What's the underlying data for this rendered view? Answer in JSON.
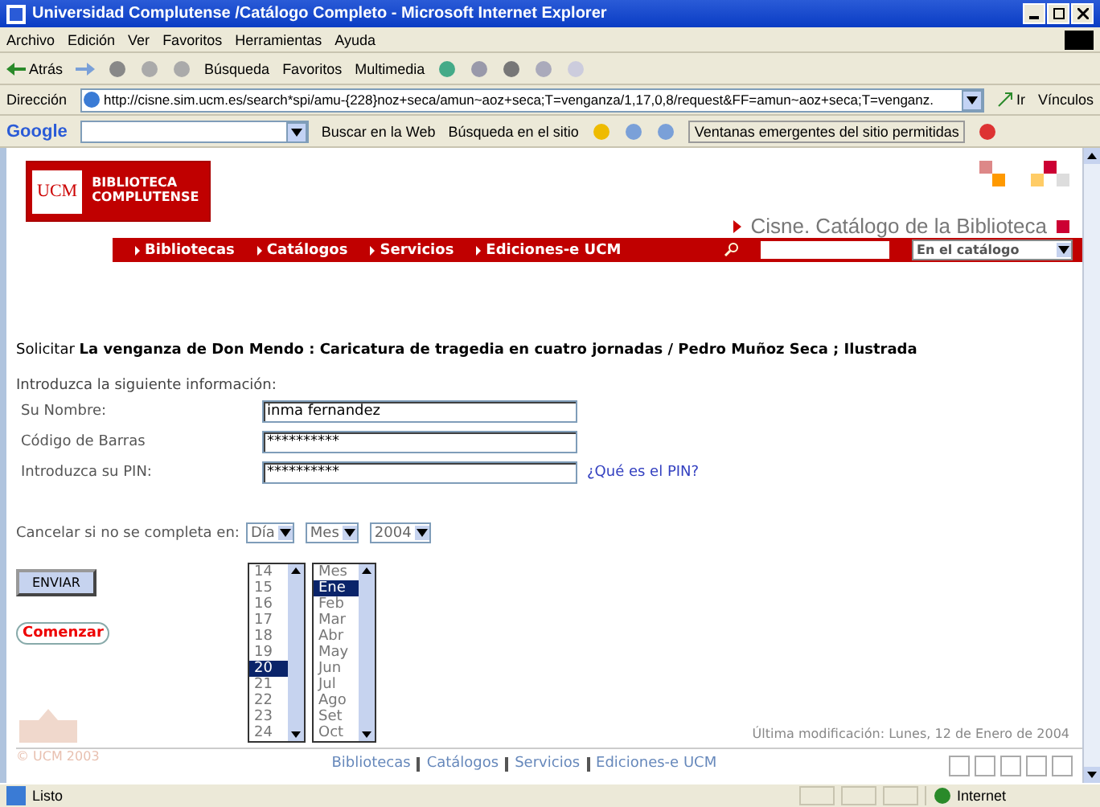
{
  "window": {
    "title": "Universidad Complutense /Catálogo Completo - Microsoft Internet Explorer"
  },
  "menu": [
    "Archivo",
    "Edición",
    "Ver",
    "Favoritos",
    "Herramientas",
    "Ayuda"
  ],
  "toolbar": {
    "back": "Atrás",
    "search": "Búsqueda",
    "favorites": "Favoritos",
    "media": "Multimedia"
  },
  "address": {
    "label": "Dirección",
    "url": "http://cisne.sim.ucm.es/search*spi/amu-{228}noz+seca/amun~aoz+seca;T=venganza/1,17,0,8/request&FF=amun~aoz+seca;T=venganz.",
    "go": "Ir",
    "links": "Vínculos"
  },
  "google_bar": {
    "logo": "Google",
    "web_search": "Buscar en la Web",
    "site_search": "Búsqueda en el sitio",
    "popups": "Ventanas emergentes del sitio permitidas"
  },
  "page": {
    "logo_mark": "UCM",
    "logo_text": [
      "BIBLIOTECA",
      "COMPLUTENSE"
    ],
    "catalog_title": "Cisne. Catálogo de la Biblioteca",
    "nav": [
      "Bibliotecas",
      "Catálogos",
      "Servicios",
      "Ediciones-e UCM"
    ],
    "search_scope": "En el catálogo",
    "request_label": "Solicitar",
    "request_title": "La venganza de Don Mendo : Caricatura de tragedia en cuatro jornadas / Pedro Muñoz Seca ; Ilustrada",
    "intro": "Introduzca la siguiente información:",
    "fields": [
      {
        "label": "Su Nombre:",
        "value": "inma fernandez"
      },
      {
        "label": "Código de Barras",
        "value": "**********"
      },
      {
        "label": "Introduzca su PIN:",
        "value": "**********"
      }
    ],
    "pin_link": "¿Qué es el PIN?",
    "cancel_label": "Cancelar si no se completa en:",
    "selects": [
      "Día",
      "Mes",
      "2004"
    ],
    "day_options": [
      {
        "label": "14",
        "selected": false
      },
      {
        "label": "15",
        "selected": false
      },
      {
        "label": "16",
        "selected": false
      },
      {
        "label": "17",
        "selected": false
      },
      {
        "label": "18",
        "selected": false
      },
      {
        "label": "19",
        "selected": false
      },
      {
        "label": "20",
        "selected": true
      },
      {
        "label": "21",
        "selected": false
      },
      {
        "label": "22",
        "selected": false
      },
      {
        "label": "23",
        "selected": false
      },
      {
        "label": "24",
        "selected": false
      }
    ],
    "month_options": [
      {
        "label": "Mes",
        "selected": false
      },
      {
        "label": "Ene",
        "selected": true
      },
      {
        "label": "Feb",
        "selected": false
      },
      {
        "label": "Mar",
        "selected": false
      },
      {
        "label": "Abr",
        "selected": false
      },
      {
        "label": "May",
        "selected": false
      },
      {
        "label": "Jun",
        "selected": false
      },
      {
        "label": "Jul",
        "selected": false
      },
      {
        "label": "Ago",
        "selected": false
      },
      {
        "label": "Set",
        "selected": false
      },
      {
        "label": "Oct",
        "selected": false
      }
    ],
    "submit": "ENVIAR",
    "start": "Comenzar",
    "last_modified": "Última modificación: Lunes, 12 de Enero de 2004",
    "copyright": "© UCM 2003",
    "footer_links": [
      "Bibliotecas",
      "Catálogos",
      "Servicios",
      "Ediciones-e UCM"
    ]
  },
  "status_bar": {
    "text": "Listo",
    "zone": "Internet"
  }
}
